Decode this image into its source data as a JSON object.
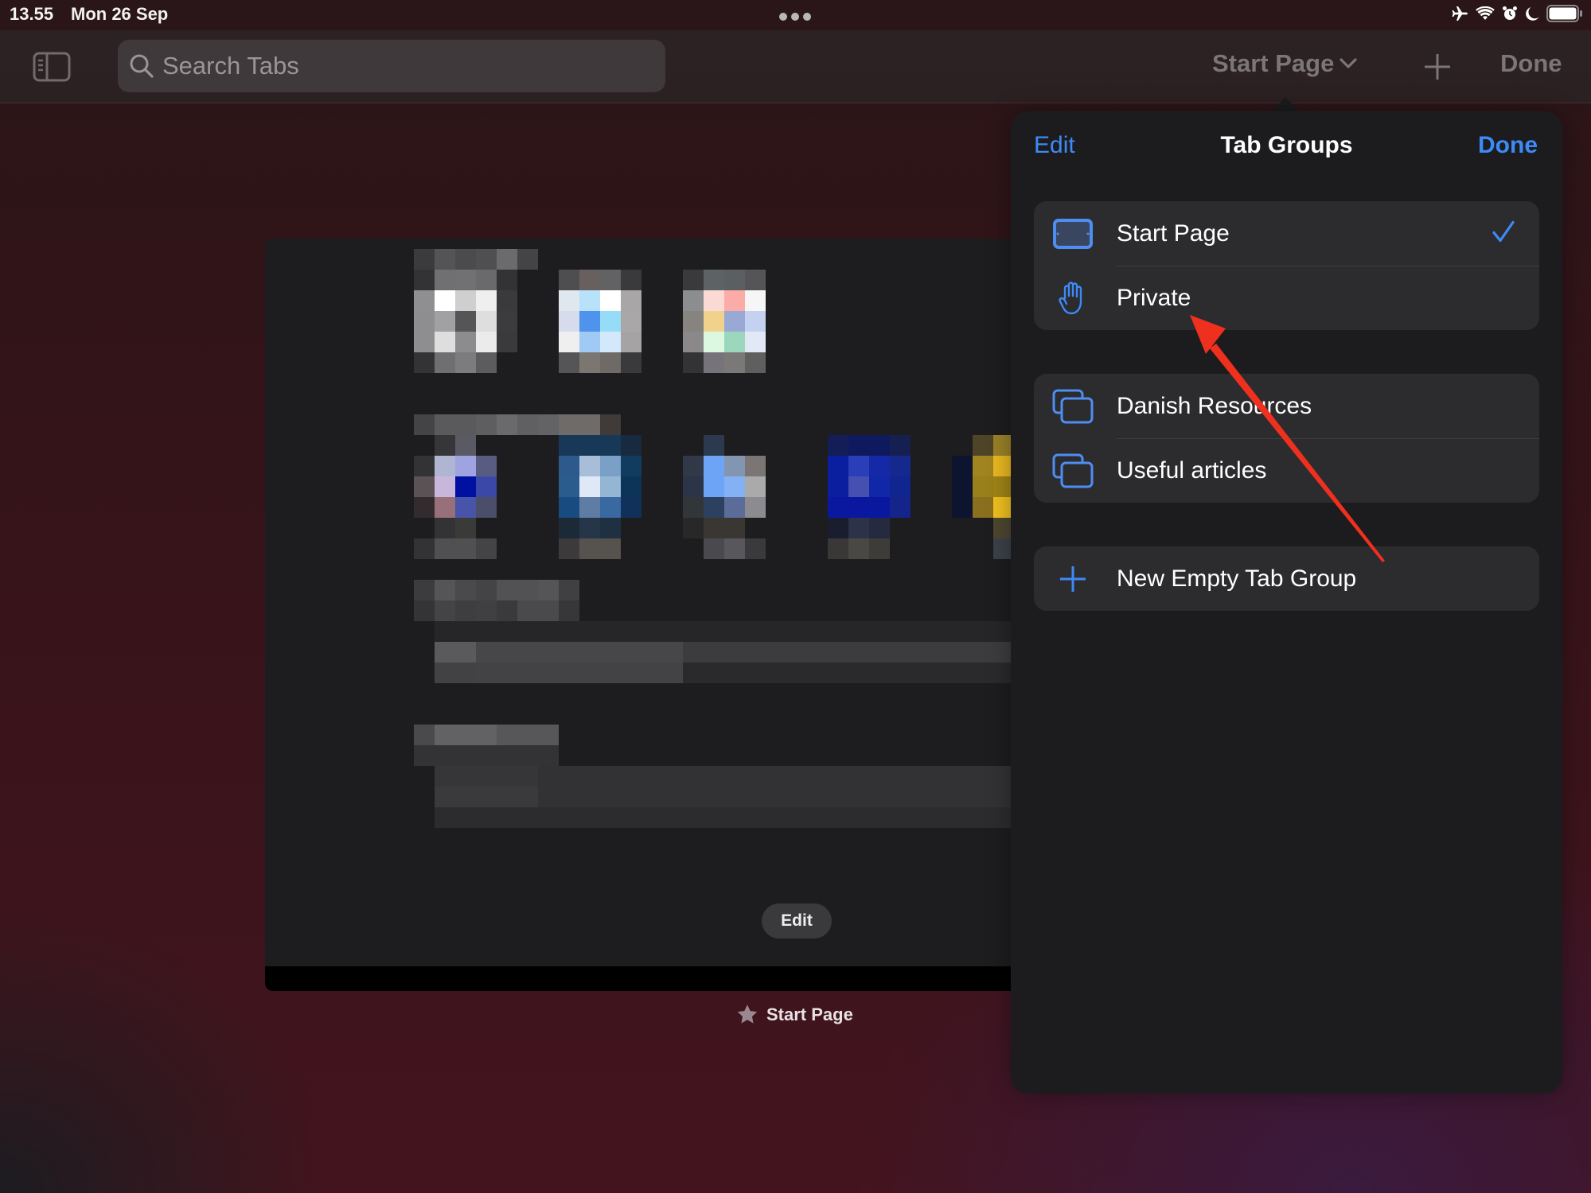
{
  "status_bar": {
    "time": "13.55",
    "date": "Mon 26 Sep",
    "icons": [
      "airplane-icon",
      "wifi-icon",
      "alarm-icon",
      "moon-icon",
      "battery-icon"
    ]
  },
  "toolbar": {
    "search_placeholder": "Search Tabs",
    "tab_group_selector": "Start Page",
    "done_label": "Done"
  },
  "tab_card": {
    "edit_label": "Edit",
    "title": "Start Page",
    "content_note": "pixelated preview"
  },
  "popover": {
    "edit_label": "Edit",
    "title": "Tab Groups",
    "done_label": "Done",
    "sections": [
      {
        "items": [
          {
            "label": "Start Page",
            "icon": "ipad-icon",
            "selected": true
          },
          {
            "label": "Private",
            "icon": "hand-icon",
            "selected": false
          }
        ]
      },
      {
        "items": [
          {
            "label": "Danish Resources",
            "icon": "tab-group-icon",
            "selected": false
          },
          {
            "label": "Useful articles",
            "icon": "tab-group-icon",
            "selected": false
          }
        ]
      },
      {
        "items": [
          {
            "label": "New Empty Tab Group",
            "icon": "plus-icon",
            "selected": false
          }
        ]
      }
    ]
  },
  "colors": {
    "accent": "#3d8af7",
    "popover_bg": "#1c1c1e",
    "row_bg": "#2c2c2e",
    "annotation": "#f0301e"
  },
  "annotation": {
    "type": "arrow",
    "points_to": "Private"
  }
}
